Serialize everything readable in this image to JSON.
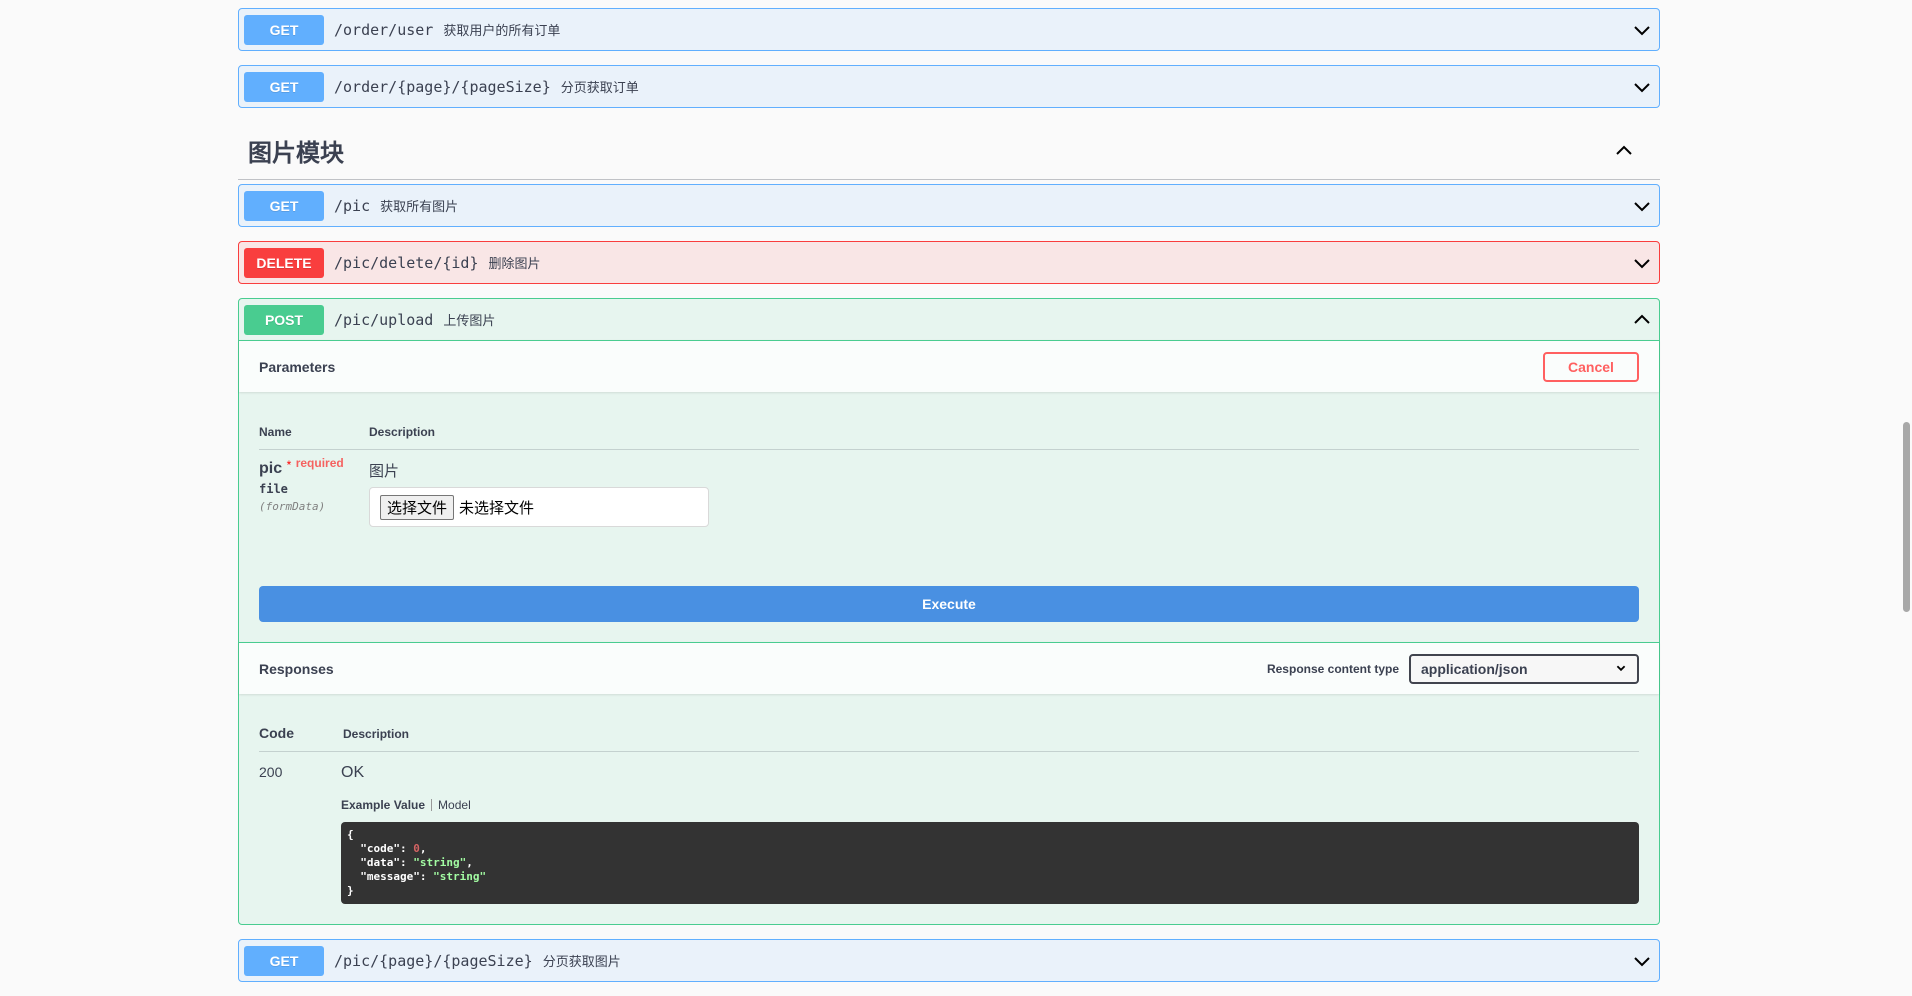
{
  "ops_top": [
    {
      "method": "GET",
      "path": "/order/user",
      "desc": "获取用户的所有订单"
    },
    {
      "method": "GET",
      "path": "/order/{page}/{pageSize}",
      "desc": "分页获取订单"
    }
  ],
  "tag": {
    "title": "图片模块"
  },
  "pic_ops": [
    {
      "method": "GET",
      "path": "/pic",
      "desc": "获取所有图片"
    },
    {
      "method": "DELETE",
      "path": "/pic/delete/{id}",
      "desc": "删除图片"
    }
  ],
  "upload": {
    "method": "POST",
    "path": "/pic/upload",
    "desc": "上传图片",
    "parameters_title": "Parameters",
    "cancel_label": "Cancel",
    "col_name": "Name",
    "col_description": "Description",
    "param": {
      "name": "pic",
      "star": "*",
      "required": "required",
      "type": "file",
      "in": "(formData)",
      "description": "图片",
      "file_button": "选择文件",
      "file_none": "未选择文件"
    },
    "execute_label": "Execute",
    "responses_title": "Responses",
    "response_content_type_label": "Response content type",
    "response_content_type": "application/json",
    "resp_col_code": "Code",
    "resp_col_desc": "Description",
    "response": {
      "code": "200",
      "desc": "OK",
      "tab_example": "Example Value",
      "tab_model": "Model",
      "example": {
        "open": "{",
        "code_key": "\"code\"",
        "code_val": "0",
        "data_key": "\"data\"",
        "data_val": "\"string\"",
        "message_key": "\"message\"",
        "message_val": "\"string\"",
        "close": "}"
      }
    }
  },
  "bottom_op": {
    "method": "GET",
    "path": "/pic/{page}/{pageSize}",
    "desc": "分页获取图片"
  },
  "colors": {
    "get": "#61affe",
    "delete": "#f93e3e",
    "post": "#49cc90",
    "execute": "#4990e2",
    "cancel": "#ff6060"
  }
}
